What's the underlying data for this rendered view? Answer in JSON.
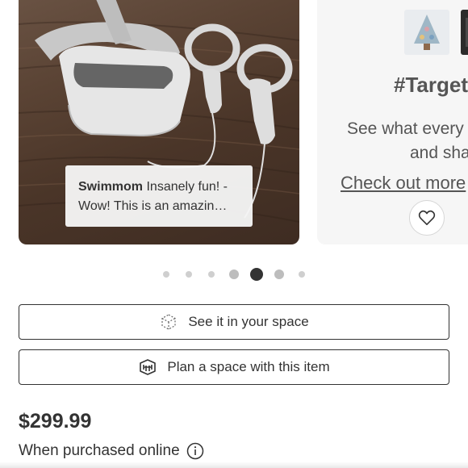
{
  "carousel": {
    "review": {
      "author": "Swimmom",
      "text_line1": "Insanely fun! -",
      "text_line2": "Wow! This is an amazin…"
    },
    "social": {
      "title": "#Target",
      "desc_line1": "See what every",
      "desc_line2": "and sha",
      "link": "Check out more"
    },
    "dots": {
      "count": 7,
      "active_index": 4
    }
  },
  "actions": {
    "view_in_space": "See it in your space",
    "plan_space": "Plan a space with this item"
  },
  "product": {
    "price": "$299.99",
    "purchase_note": "When purchased online"
  },
  "colors": {
    "text": "#333333",
    "active_dot": "#333333",
    "inactive_dot": "#cfcfcf"
  }
}
